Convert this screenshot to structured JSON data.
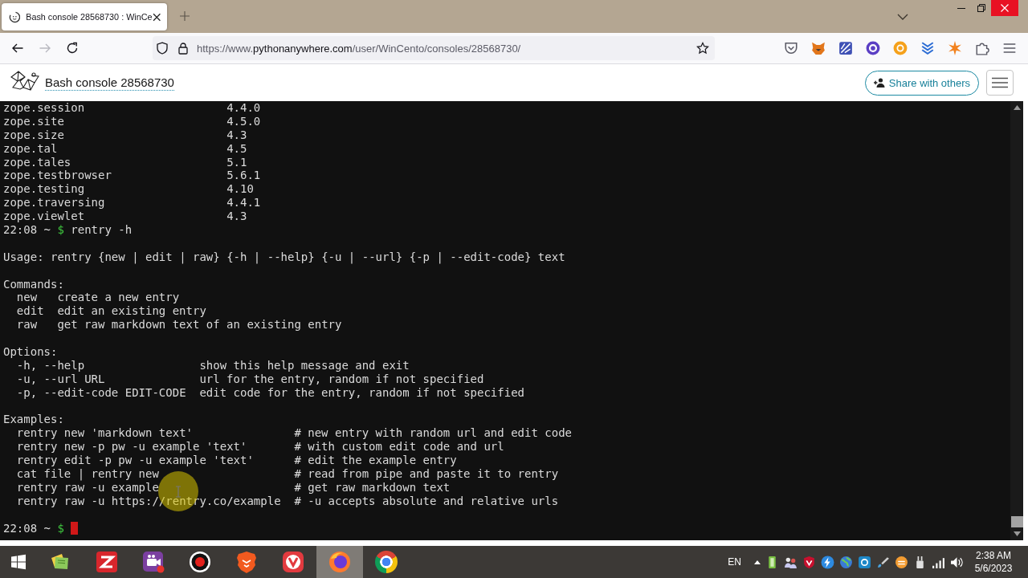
{
  "browser": {
    "tabs": [
      {
        "title": "Bash console 28568730 : WinCe",
        "selected": true
      }
    ],
    "nav": {
      "back": {
        "disabled": false
      },
      "forward": {
        "disabled": true
      }
    },
    "url": "https://www.pythonanywhere.com/user/WinCento/consoles/28568730/"
  },
  "header": {
    "title": "Bash console 28568730",
    "share_button": "Share with others"
  },
  "terminal": {
    "lines": [
      {
        "kind": "package",
        "name": "zope.session",
        "version": "4.4.0"
      },
      {
        "kind": "package",
        "name": "zope.site",
        "version": "4.5.0"
      },
      {
        "kind": "package",
        "name": "zope.size",
        "version": "4.3"
      },
      {
        "kind": "package",
        "name": "zope.tal",
        "version": "4.5"
      },
      {
        "kind": "package",
        "name": "zope.tales",
        "version": "5.1"
      },
      {
        "kind": "package",
        "name": "zope.testbrowser",
        "version": "5.6.1"
      },
      {
        "kind": "package",
        "name": "zope.testing",
        "version": "4.10"
      },
      {
        "kind": "package",
        "name": "zope.traversing",
        "version": "4.4.1"
      },
      {
        "kind": "package",
        "name": "zope.viewlet",
        "version": "4.3"
      },
      {
        "kind": "prompt",
        "time": "22:08",
        "path": "~",
        "symbol": "$",
        "command": "rentry -h"
      },
      {
        "kind": "blank"
      },
      {
        "kind": "text",
        "text": "Usage: rentry {new | edit | raw} {-h | --help} {-u | --url} {-p | --edit-code} text"
      },
      {
        "kind": "blank"
      },
      {
        "kind": "heading",
        "text": "Commands:"
      },
      {
        "kind": "command",
        "name": "new",
        "description": "create a new entry"
      },
      {
        "kind": "command",
        "name": "edit",
        "description": "edit an existing entry"
      },
      {
        "kind": "command",
        "name": "raw",
        "description": "get raw markdown text of an existing entry"
      },
      {
        "kind": "blank"
      },
      {
        "kind": "heading",
        "text": "Options:"
      },
      {
        "kind": "option",
        "flags": "-h, --help",
        "description": "show this help message and exit"
      },
      {
        "kind": "option",
        "flags": "-u, --url URL",
        "description": "url for the entry, random if not specified"
      },
      {
        "kind": "option",
        "flags": "-p, --edit-code EDIT-CODE",
        "description": "edit code for the entry, random if not specified"
      },
      {
        "kind": "blank"
      },
      {
        "kind": "heading",
        "text": "Examples:"
      },
      {
        "kind": "example",
        "command": "rentry new 'markdown text'",
        "comment": "# new entry with random url and edit code"
      },
      {
        "kind": "example",
        "command": "rentry new -p pw -u example 'text'",
        "comment": "# with custom edit code and url"
      },
      {
        "kind": "example",
        "command": "rentry edit -p pw -u example 'text'",
        "comment": "# edit the example entry"
      },
      {
        "kind": "example",
        "command": "cat file | rentry new",
        "comment": "# read from pipe and paste it to rentry"
      },
      {
        "kind": "example",
        "command": "rentry raw -u example",
        "comment": "# get raw markdown text"
      },
      {
        "kind": "example",
        "command": "rentry raw -u https://rentry.co/example",
        "comment": "# -u accepts absolute and relative urls"
      },
      {
        "kind": "blank"
      },
      {
        "kind": "prompt",
        "time": "22:08",
        "path": "~",
        "symbol": "$",
        "cursor": true
      }
    ]
  },
  "taskbar": {
    "apps": [
      {
        "selected": false
      },
      {
        "selected": false
      },
      {
        "selected": false
      },
      {
        "selected": false
      },
      {
        "selected": false
      },
      {
        "selected": false
      },
      {
        "selected": true
      },
      {
        "selected": false
      }
    ],
    "language": "EN",
    "time": "2:38 AM",
    "date": "5/6/2023"
  }
}
